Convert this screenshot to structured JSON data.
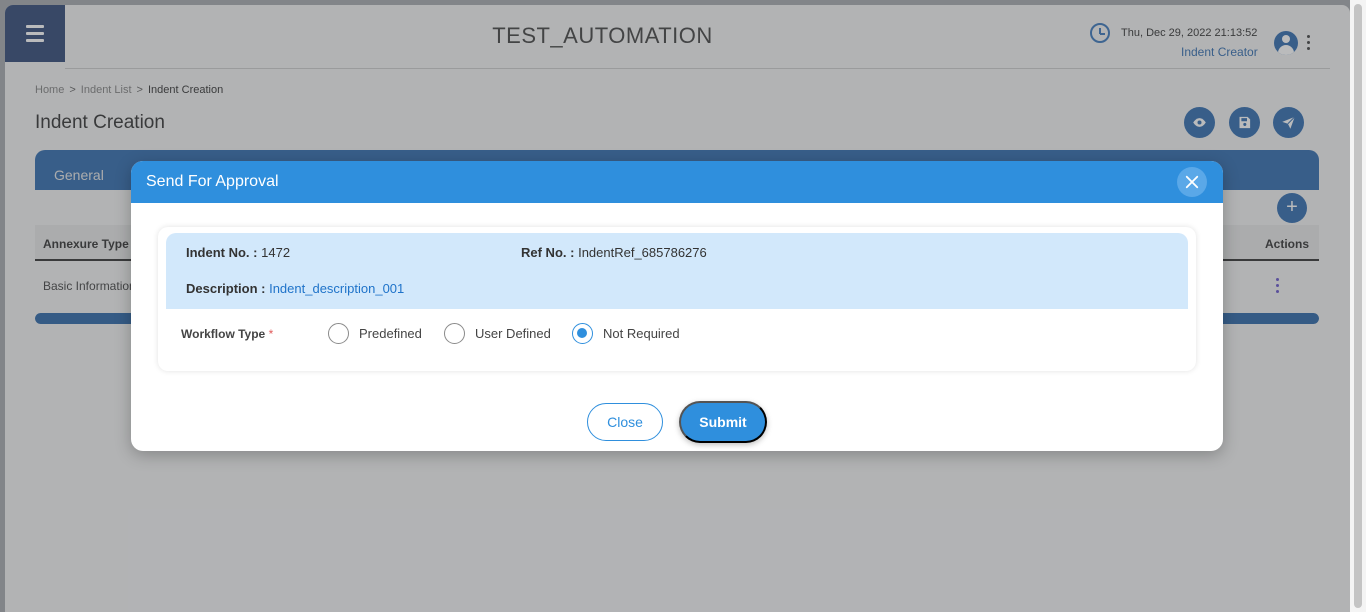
{
  "header": {
    "title": "TEST_AUTOMATION",
    "datetime": "Thu, Dec 29, 2022 21:13:52",
    "role": "Indent Creator"
  },
  "breadcrumb": {
    "items": [
      "Home",
      "Indent List",
      "Indent Creation"
    ],
    "separator": ">"
  },
  "page": {
    "title": "Indent Creation"
  },
  "card": {
    "tab_label": "General",
    "add_label": "+",
    "columns": [
      "Annexure Type",
      "Actions"
    ],
    "required_mark": "*",
    "rows": [
      {
        "annexure_type": "Basic Information"
      }
    ],
    "progress_fraction": 1.0
  },
  "modal": {
    "title": "Send For Approval",
    "indent_no_label": "Indent No. :",
    "indent_no_value": "1472",
    "ref_no_label": "Ref No. :",
    "ref_no_value": "IndentRef_685786276",
    "description_label": "Description :",
    "description_value": "Indent_description_001",
    "workflow_label": "Workflow Type",
    "required_mark": "*",
    "workflow_options": [
      "Predefined",
      "User Defined",
      "Not Required"
    ],
    "workflow_selected": "Not Required",
    "close_label": "Close",
    "submit_label": "Submit"
  },
  "colors": {
    "primary": "#2f8fdd",
    "nav_dark": "#1f3a6b",
    "info_band": "#d2e8fb"
  },
  "icons": [
    "menu-icon",
    "clock-icon",
    "user-avatar-icon",
    "more-vert-icon",
    "eye-icon",
    "save-icon",
    "send-icon",
    "plus-icon",
    "close-icon"
  ]
}
